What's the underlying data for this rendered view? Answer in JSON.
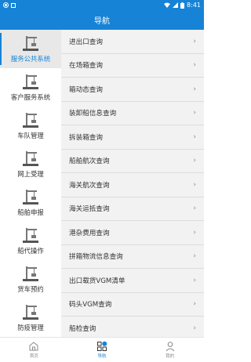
{
  "status_bar": {
    "time": "8:41",
    "icons": [
      "cloud-icon",
      "sim-icon",
      "wifi-icon",
      "signal-icon",
      "battery-icon"
    ]
  },
  "header": {
    "title": "导航"
  },
  "sidebar": {
    "items": [
      {
        "label": "服务公共系统",
        "active": true
      },
      {
        "label": "客户服务系统"
      },
      {
        "label": "车队管理"
      },
      {
        "label": "网上受理"
      },
      {
        "label": "船舶申报"
      },
      {
        "label": "船代操作"
      },
      {
        "label": "货车预约"
      },
      {
        "label": "防疫管理"
      }
    ]
  },
  "menu": {
    "items": [
      {
        "label": "进出口查询"
      },
      {
        "label": "在场箱查询"
      },
      {
        "label": "箱动态查询"
      },
      {
        "label": "装卸船信息查询"
      },
      {
        "label": "拆装箱查询"
      },
      {
        "label": "船舶航次查询"
      },
      {
        "label": "海关航次查询"
      },
      {
        "label": "海关运抵查询"
      },
      {
        "label": "港杂费用查询"
      },
      {
        "label": "拼箱物流信息查询"
      },
      {
        "label": "出口载货VGM清单"
      },
      {
        "label": "码头VGM查询"
      },
      {
        "label": "船检查询"
      }
    ],
    "chevron": "›"
  },
  "tabbar": {
    "tabs": [
      {
        "label": "首页",
        "icon": "home-icon"
      },
      {
        "label": "导航",
        "icon": "nav-grid-icon",
        "active": true
      },
      {
        "label": "我的",
        "icon": "user-icon"
      }
    ]
  },
  "colors": {
    "primary": "#1683d6",
    "active_bg": "#e8e8e8",
    "list_bg": "#f2f2f2"
  }
}
